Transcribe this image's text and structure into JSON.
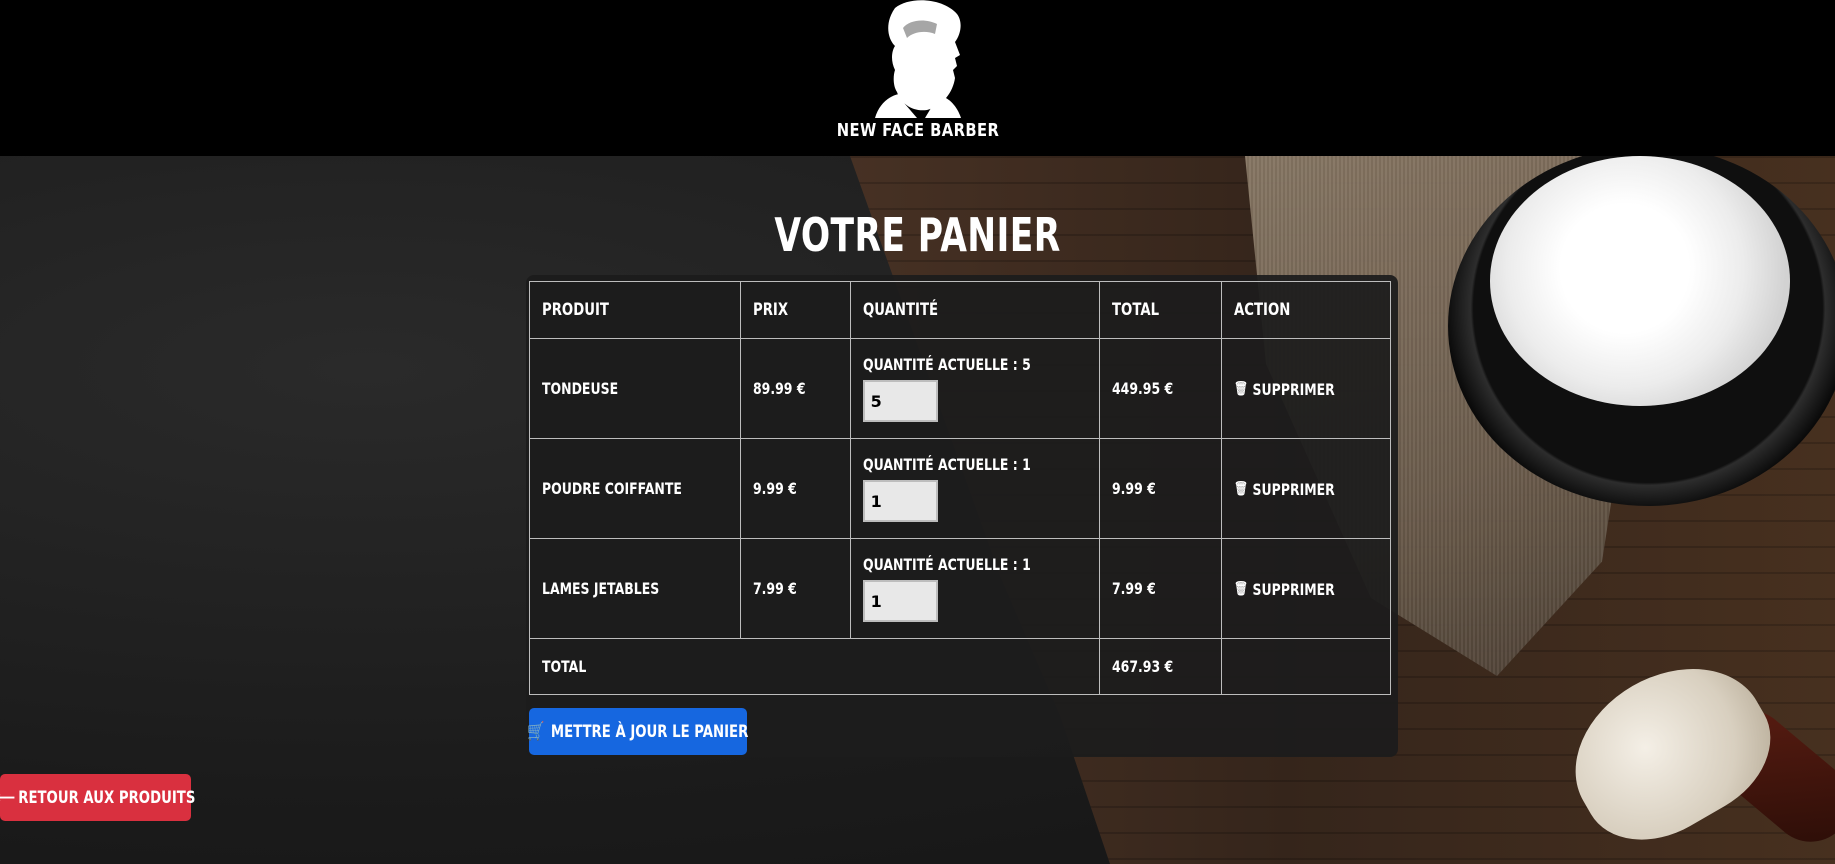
{
  "header": {
    "logo_text": "NEW FACE BARBER"
  },
  "page": {
    "title": "VOTRE PANIER"
  },
  "cart": {
    "columns": [
      "PRODUIT",
      "PRIX",
      "QUANTITÉ",
      "TOTAL",
      "ACTION"
    ],
    "items": [
      {
        "product": "TONDEUSE",
        "price": "89.99 €",
        "qty_label": "QUANTITÉ ACTUELLE : 5",
        "qty_value": "5",
        "total": "449.95 €",
        "action": "SUPPRIMER"
      },
      {
        "product": "POUDRE COIFFANTE",
        "price": "9.99 €",
        "qty_label": "QUANTITÉ ACTUELLE : 1",
        "qty_value": "1",
        "total": "9.99 €",
        "action": "SUPPRIMER"
      },
      {
        "product": "LAMES JETABLES",
        "price": "7.99 €",
        "qty_label": "QUANTITÉ ACTUELLE : 1",
        "qty_value": "1",
        "total": "7.99 €",
        "action": "SUPPRIMER"
      }
    ],
    "total_label": "TOTAL",
    "total_value": "467.93 €"
  },
  "buttons": {
    "update_label": "METTRE À JOUR LE PANIER",
    "back_label": "RETOUR AUX PRODUITS"
  },
  "icons": {
    "trash": "trash-icon",
    "cart": "cart-icon",
    "back_arrow": "arrow-left-icon"
  },
  "colors": {
    "header_bg": "#000000",
    "update_button": "#1667e0",
    "back_button": "#d9303f"
  }
}
